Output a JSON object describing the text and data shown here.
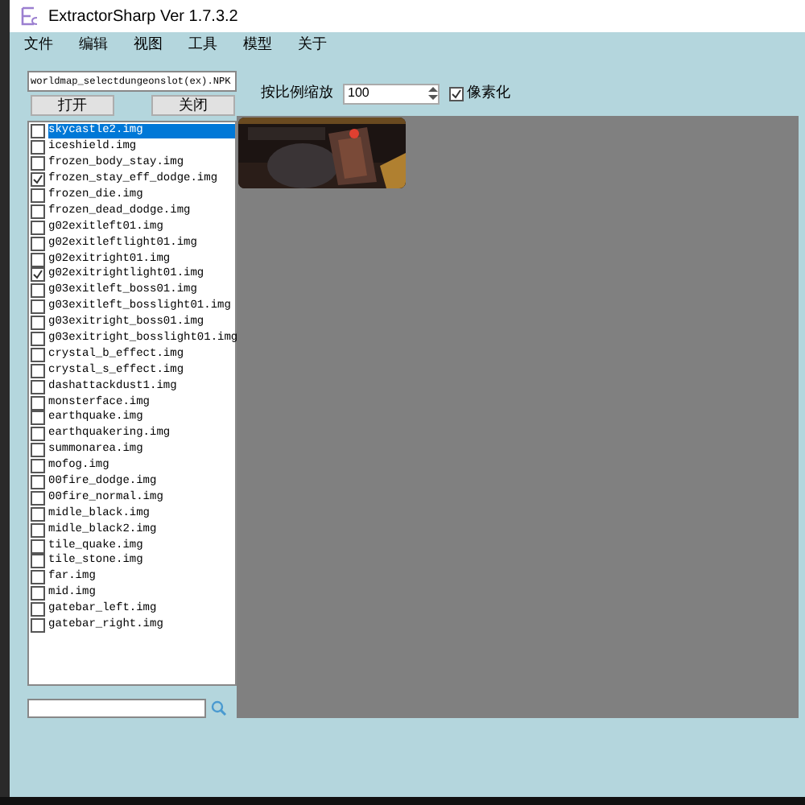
{
  "window": {
    "title": "ExtractorSharp Ver 1.7.3.2"
  },
  "menu": [
    "文件",
    "编辑",
    "视图",
    "工具",
    "模型",
    "关于"
  ],
  "file_path": {
    "value": "worldmap_selectdungeonslot(ex).NPK"
  },
  "buttons": [
    "打开",
    "关闭"
  ],
  "scale": {
    "label": "按比例缩放",
    "value": "100"
  },
  "pixelate": {
    "label": "像素化",
    "checked": true
  },
  "files": [
    {
      "name": "skycastle2.img",
      "checked": false,
      "selected": true
    },
    {
      "name": "iceshield.img",
      "checked": false,
      "selected": false
    },
    {
      "name": "frozen_body_stay.img",
      "checked": false,
      "selected": false
    },
    {
      "name": "frozen_stay_eff_dodge.img",
      "checked": true,
      "selected": false
    },
    {
      "name": "frozen_die.img",
      "checked": false,
      "selected": false
    },
    {
      "name": "frozen_dead_dodge.img",
      "checked": false,
      "selected": false
    },
    {
      "name": "g02exitleft01.img",
      "checked": false,
      "selected": false
    },
    {
      "name": "g02exitleftlight01.img",
      "checked": false,
      "selected": false
    },
    {
      "name": "g02exitright01.img",
      "checked": false,
      "selected": false
    },
    {
      "name": "g02exitrightlight01.img",
      "checked": true,
      "selected": false
    },
    {
      "name": "g03exitleft_boss01.img",
      "checked": false,
      "selected": false
    },
    {
      "name": "g03exitleft_bosslight01.img",
      "checked": false,
      "selected": false
    },
    {
      "name": "g03exitright_boss01.img",
      "checked": false,
      "selected": false
    },
    {
      "name": "g03exitright_bosslight01.img",
      "checked": false,
      "selected": false
    },
    {
      "name": "crystal_b_effect.img",
      "checked": false,
      "selected": false
    },
    {
      "name": "crystal_s_effect.img",
      "checked": false,
      "selected": false
    },
    {
      "name": "dashattackdust1.img",
      "checked": false,
      "selected": false
    },
    {
      "name": "monsterface.img",
      "checked": false,
      "selected": false
    },
    {
      "name": "earthquake.img",
      "checked": false,
      "selected": false
    },
    {
      "name": "earthquakering.img",
      "checked": false,
      "selected": false
    },
    {
      "name": "summonarea.img",
      "checked": false,
      "selected": false
    },
    {
      "name": "mofog.img",
      "checked": false,
      "selected": false
    },
    {
      "name": "00fire_dodge.img",
      "checked": false,
      "selected": false
    },
    {
      "name": "00fire_normal.img",
      "checked": false,
      "selected": false
    },
    {
      "name": "midle_black.img",
      "checked": false,
      "selected": false
    },
    {
      "name": "midle_black2.img",
      "checked": false,
      "selected": false
    },
    {
      "name": "tile_quake.img",
      "checked": false,
      "selected": false
    },
    {
      "name": "tile_stone.img",
      "checked": false,
      "selected": false
    },
    {
      "name": "far.img",
      "checked": false,
      "selected": false
    },
    {
      "name": "mid.img",
      "checked": false,
      "selected": false
    },
    {
      "name": "gatebar_left.img",
      "checked": false,
      "selected": false
    },
    {
      "name": "gatebar_right.img",
      "checked": false,
      "selected": false
    }
  ]
}
